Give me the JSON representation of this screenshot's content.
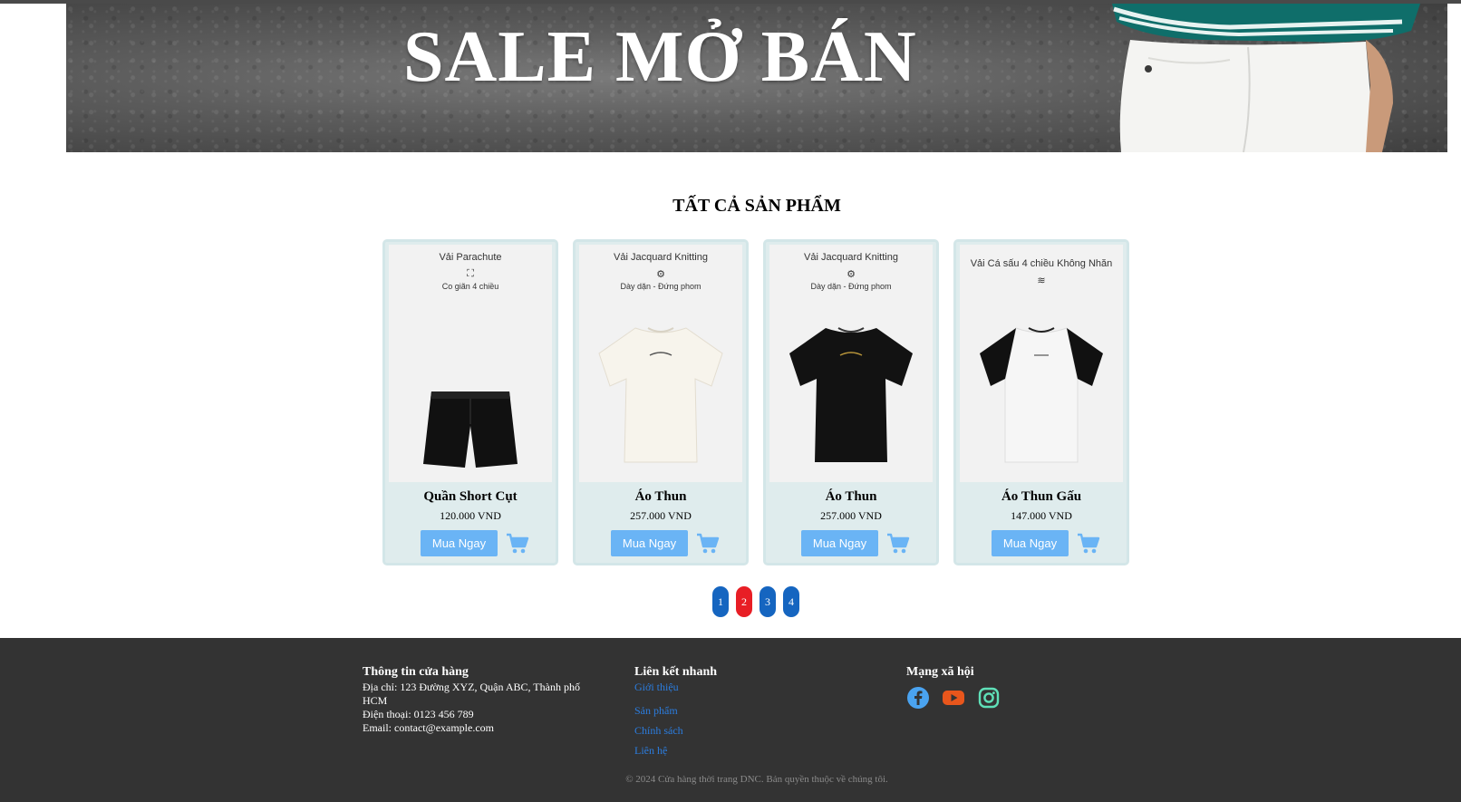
{
  "banner": {
    "title": "SALE MỞ BÁN"
  },
  "section": {
    "title": "TẤT CẢ SẢN PHẨM"
  },
  "products": [
    {
      "feature_line1": "Vải Parachute",
      "feature_icon": "expand-icon",
      "feature_line2": "Co giãn 4 chiều",
      "name": "Quần Short Cụt",
      "price": "120.000 VND",
      "buy_label": "Mua Ngay",
      "image": "black-shorts"
    },
    {
      "feature_line1": "Vải Jacquard Knitting",
      "feature_icon": "gear-icon",
      "feature_line2": "Dày dặn - Đứng phom",
      "name": "Áo Thun",
      "price": "257.000 VND",
      "buy_label": "Mua Ngay",
      "image": "cream-tshirt"
    },
    {
      "feature_line1": "Vải Jacquard Knitting",
      "feature_icon": "gear-icon",
      "feature_line2": "Dày dặn - Đứng phom",
      "name": "Áo Thun",
      "price": "257.000 VND",
      "buy_label": "Mua Ngay",
      "image": "black-tshirt"
    },
    {
      "feature_line1": "Vải Cá sấu 4 chiều Không Nhăn",
      "feature_icon": "no-wrinkle-icon",
      "feature_line2": "",
      "name": "Áo Thun Gấu",
      "price": "147.000 VND",
      "buy_label": "Mua Ngay",
      "image": "raglan-tshirt"
    }
  ],
  "pagination": {
    "pages": [
      "1",
      "2",
      "3",
      "4"
    ],
    "current": "2"
  },
  "footer": {
    "store_info": {
      "heading": "Thông tin cửa hàng",
      "address_line1": "Địa chỉ: 123 Đường XYZ, Quận ABC, Thành phố",
      "address_line2": "HCM",
      "phone": "Điện thoại: 0123 456 789",
      "email": "Email: contact@example.com"
    },
    "quick_links": {
      "heading": "Liên kết nhanh",
      "items": [
        "Giới thiệu",
        "Sản phẩm",
        "Chính sách",
        "Liên hệ"
      ]
    },
    "social": {
      "heading": "Mạng xã hội",
      "icons": [
        "facebook-icon",
        "youtube-icon",
        "instagram-icon"
      ]
    },
    "copyright": "© 2024 Cửa hàng thời trang DNC. Bản quyền thuộc về chúng tôi."
  },
  "colors": {
    "buy_button": "#6ab4f5",
    "cart_icon": "#6ab4f5",
    "page_button": "#1565c0",
    "page_active": "#e81e25",
    "footer_bg": "#333333",
    "card_bg": "#dfeced",
    "link": "#2b7de0"
  }
}
